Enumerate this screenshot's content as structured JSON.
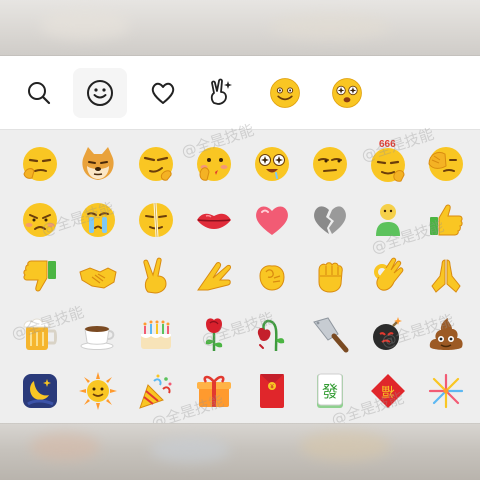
{
  "watermark": "@全是技能",
  "colors": {
    "panel_bg": "#eeeeee",
    "toolbar_bg": "#ffffff",
    "active_tab_bg": "#f5f5f5",
    "emoji_yellow": "#f9c623",
    "badge_red": "#e2392f"
  },
  "toolbar": {
    "tabs": [
      {
        "name": "search",
        "icon": "search-icon"
      },
      {
        "name": "emoji",
        "icon": "smiley-outline-icon",
        "active": true
      },
      {
        "name": "favorites",
        "icon": "heart-outline-icon"
      },
      {
        "name": "gestures",
        "icon": "victory-hand-icon"
      },
      {
        "name": "classic-smile",
        "icon": "smile-face-icon"
      },
      {
        "name": "wow",
        "icon": "star-eyes-face-icon"
      }
    ]
  },
  "emoji_rows": [
    [
      "smirk-hand-face-icon",
      "doge-icon",
      "cool-sunglasses-face-icon",
      "blowing-kiss-face-icon",
      "star-eyes-drool-face-icon",
      "side-eye-face-icon",
      "666-face-icon",
      "facepalm-face-icon"
    ],
    [
      "pouting-face-icon",
      "crying-face-icon",
      "bandaged-face-icon",
      "lips-icon",
      "heart-icon",
      "broken-heart-icon",
      "green-figure-icon",
      "thumbs-up-icon"
    ],
    [
      "thumbs-down-icon",
      "handshake-icon",
      "victory-hand-icon",
      "slap-hand-icon",
      "fist-icon",
      "ok-hand-icon",
      "praying-hands-icon"
    ],
    [
      "beer-mug-icon",
      "coffee-cup-icon",
      "birthday-cake-icon",
      "rose-icon",
      "wilted-rose-icon",
      "kitchen-knife-icon",
      "bomb-icon",
      "poop-icon"
    ],
    [
      "moon-night-icon",
      "sun-face-icon",
      "party-popper-icon",
      "gift-box-icon",
      "red-envelope-icon",
      "mahjong-fa-tile-icon",
      "fortune-fu-icon",
      "fireworks-icon"
    ]
  ],
  "emoji_row3_extra": "fist-bump-icon",
  "badge_text": "666",
  "red_envelope_text": "¥",
  "mahjong_text": "發",
  "fortune_text": "福"
}
